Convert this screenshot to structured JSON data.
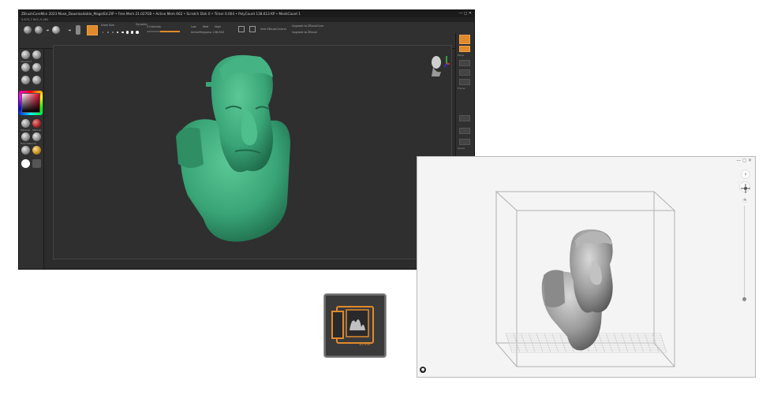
{
  "zbrush": {
    "title": "ZBrushCoreMini 2023   Mose_Downloadable_Mage/Ed.ZIP   • Free Mem 21.027GB • Active Mem 662 • Scratch Disk 0 • Timer 0.004 • PolyCount 138.613 KP • MeshCount 1",
    "window_controls": "— ◻ ✕",
    "subtitle": "3.675,7 843,-9,262",
    "shelf": {
      "draw_size_label": "Draw Size",
      "dynamic_label": "Dynamic",
      "z_intensity_label": "Z Intensity",
      "low": "Low",
      "med": "Med",
      "high": "High",
      "active_polygons": "ActivePolygons: 138,616",
      "visit_label": "Visit ZBrushCentral",
      "upgrade_core": "Upgrade to ZBrushCore",
      "upgrade_zbrush": "Upgrade to ZBrush"
    },
    "left_tools": [
      "Standard",
      "Clay",
      "Move",
      "Smooth",
      "Inflate",
      "Pinch"
    ],
    "material_labels": [
      "Material",
      "MatCap"
    ],
    "texture_labels": [
      "BasicMaterial",
      "PolyPaint"
    ],
    "right_labels": [
      "Persp",
      "Floor",
      "Frame",
      "Xpose"
    ],
    "brush_sizes": [
      1,
      2,
      3,
      4,
      5,
      6,
      7,
      8
    ]
  },
  "tile": {
    "label": "3D Print"
  },
  "viewer": {
    "window_controls": "—  ◻  ✕",
    "back_icon": "chevron-left-icon",
    "user_icon": "user-icon"
  },
  "colors": {
    "zbrush_bg": "#2c2c2c",
    "model_green": "#3aa678",
    "accent_orange": "#e08a2c",
    "viewer_bg": "#f4f4f4",
    "print_model_gray": "#9a9a9a"
  }
}
